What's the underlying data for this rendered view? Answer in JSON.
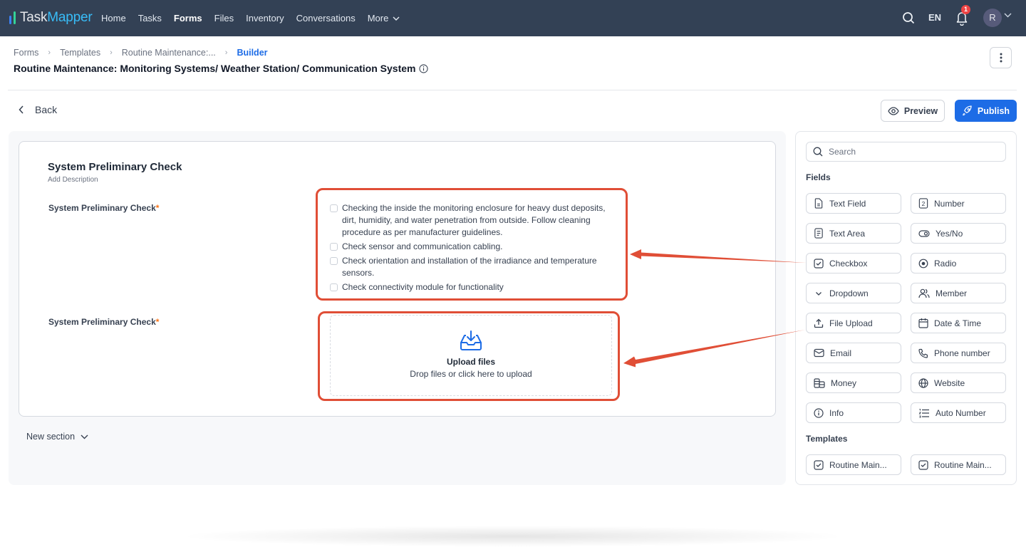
{
  "app": {
    "logo_text_a": "Task",
    "logo_text_b": "Mapper"
  },
  "nav": {
    "items": [
      {
        "label": "Home",
        "active": false
      },
      {
        "label": "Tasks",
        "active": false
      },
      {
        "label": "Forms",
        "active": true
      },
      {
        "label": "Files",
        "active": false
      },
      {
        "label": "Inventory",
        "active": false
      },
      {
        "label": "Conversations",
        "active": false
      }
    ],
    "more_label": "More",
    "language": "EN",
    "notification_count": "1",
    "avatar_initial": "R"
  },
  "header": {
    "breadcrumb": [
      "Forms",
      "Templates",
      "Routine Maintenance:...",
      "Builder"
    ],
    "title": "Routine Maintenance: Monitoring Systems/ Weather Station/ Communication System"
  },
  "toolbar": {
    "back_label": "Back",
    "preview_label": "Preview",
    "publish_label": "Publish"
  },
  "section": {
    "title": "System Preliminary Check",
    "description_placeholder": "Add Description",
    "fields": [
      {
        "label": "System Preliminary Check",
        "required": true,
        "type": "checkbox",
        "options": [
          "Checking the inside the monitoring enclosure for heavy dust deposits, dirt, humidity, and water penetration from outside. Follow cleaning procedure as per manufacturer guidelines.",
          "Check sensor and communication cabling.",
          "Check orientation and installation of the irradiance and temperature sensors.",
          "Check connectivity module for functionality"
        ]
      },
      {
        "label": "System Preliminary Check",
        "required": true,
        "type": "file-upload",
        "upload_title": "Upload files",
        "upload_subtitle": "Drop files or click here to upload"
      }
    ],
    "required_mark": "*"
  },
  "new_section_label": "New section",
  "sidebar": {
    "search_placeholder": "Search",
    "fields_heading": "Fields",
    "fields": [
      {
        "label": "Text Field",
        "icon": "text-field-icon"
      },
      {
        "label": "Number",
        "icon": "number-icon"
      },
      {
        "label": "Text Area",
        "icon": "text-area-icon"
      },
      {
        "label": "Yes/No",
        "icon": "toggle-icon"
      },
      {
        "label": "Checkbox",
        "icon": "checkbox-icon"
      },
      {
        "label": "Radio",
        "icon": "radio-icon"
      },
      {
        "label": "Dropdown",
        "icon": "chevron-down-icon"
      },
      {
        "label": "Member",
        "icon": "users-icon"
      },
      {
        "label": "File Upload",
        "icon": "upload-icon"
      },
      {
        "label": "Date & Time",
        "icon": "calendar-icon"
      },
      {
        "label": "Email",
        "icon": "mail-icon"
      },
      {
        "label": "Phone number",
        "icon": "phone-icon"
      },
      {
        "label": "Money",
        "icon": "coins-icon"
      },
      {
        "label": "Website",
        "icon": "globe-icon"
      },
      {
        "label": "Info",
        "icon": "info-icon"
      },
      {
        "label": "Auto Number",
        "icon": "list-ordered-icon"
      }
    ],
    "templates_heading": "Templates",
    "templates": [
      {
        "label": "Routine Main..."
      },
      {
        "label": "Routine Main..."
      }
    ]
  },
  "colors": {
    "nav_bg": "#334155",
    "accent": "#1d6ce6",
    "annotation": "#e04e36",
    "required": "#f97316"
  }
}
